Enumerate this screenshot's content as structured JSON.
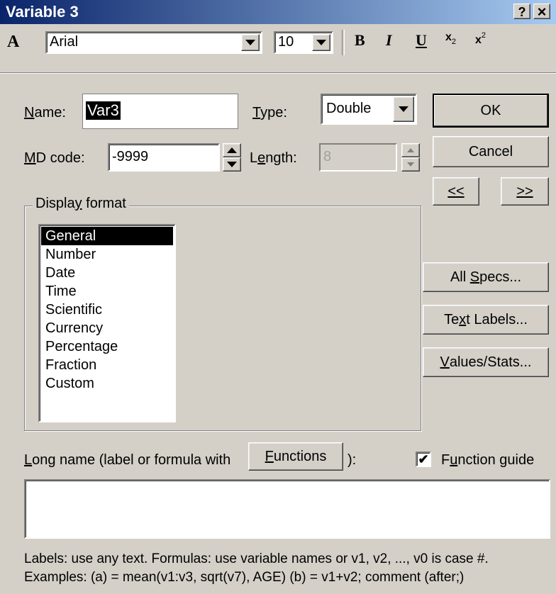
{
  "window": {
    "title": "Variable 3",
    "help_label": "?",
    "close_label": "×"
  },
  "toolbar": {
    "font_icon_label": "A",
    "font_name": "Arial",
    "font_size": "10",
    "bold_label": "B",
    "italic_label": "I",
    "underline_label": "U",
    "subscript_label": "x",
    "subscript_mark": "2",
    "superscript_label": "x",
    "superscript_mark": "2"
  },
  "fields": {
    "name_label_u": "N",
    "name_label_rest": "ame:",
    "name_value": "Var3",
    "type_label_u": "T",
    "type_label_rest": "ype:",
    "type_value": "Double",
    "md_label_u": "M",
    "md_label_rest": "D code:",
    "md_value": "-9999",
    "length_label_pre": "L",
    "length_label_u": "e",
    "length_label_rest": "ngth:",
    "length_value": "8"
  },
  "buttons": {
    "ok": "OK",
    "cancel": "Cancel",
    "prev": "<<",
    "next": ">>",
    "all_specs_pre": "All ",
    "all_specs_u": "S",
    "all_specs_rest": "pecs...",
    "text_labels_pre": "Te",
    "text_labels_u": "x",
    "text_labels_rest": "t Labels...",
    "values_stats_u": "V",
    "values_stats_rest": "alues/Stats...",
    "functions_u": "F",
    "functions_rest": "unctions"
  },
  "display_format": {
    "legend_pre": "Displa",
    "legend_u": "y",
    "legend_rest": " format",
    "items": [
      "General",
      "Number",
      "Date",
      "Time",
      "Scientific",
      "Currency",
      "Percentage",
      "Fraction",
      "Custom"
    ],
    "selected": "General"
  },
  "long_name": {
    "label_u": "L",
    "label_rest": "ong name (label or formula with",
    "label_close": "):",
    "value": ""
  },
  "function_guide": {
    "checked": true,
    "check_glyph": "✔",
    "label_pre": "F",
    "label_u": "u",
    "label_rest": "nction guide"
  },
  "help_text": {
    "line1": "Labels: use any text.  Formulas: use variable names or v1, v2, ..., v0 is case #.",
    "line2": "Examples:   (a) = mean(v1:v3, sqrt(v7), AGE)   (b) = v1+v2; comment (after;)"
  }
}
